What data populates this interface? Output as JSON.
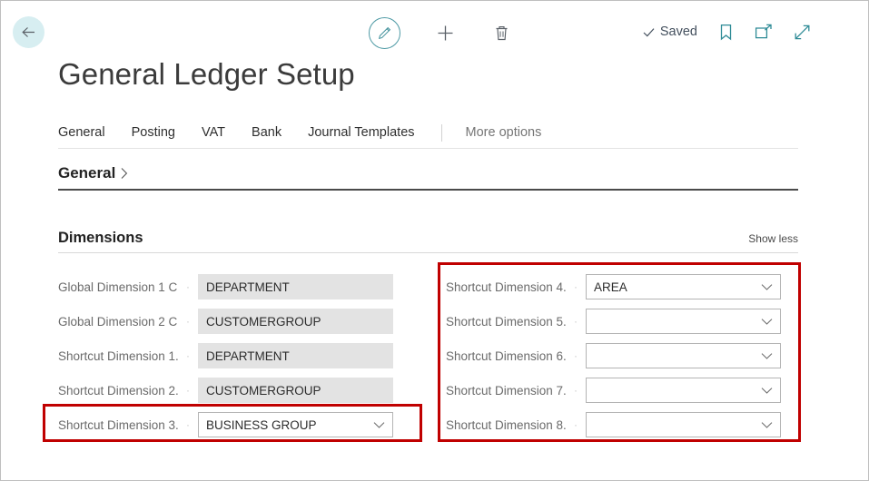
{
  "window": {
    "title": "General Ledger Setup"
  },
  "command_bar": {
    "back_label": "Back",
    "edit_label": "Edit",
    "new_label": "New",
    "delete_label": "Delete",
    "saved_status": "Saved",
    "bookmark_label": "Bookmark",
    "open_new_window_label": "Open in new window",
    "expand_label": "Expand"
  },
  "tabs": {
    "items": [
      {
        "label": "General"
      },
      {
        "label": "Posting"
      },
      {
        "label": "VAT"
      },
      {
        "label": "Bank"
      },
      {
        "label": "Journal Templates"
      }
    ],
    "more_options": "More options"
  },
  "general_section": {
    "title": "General"
  },
  "dimensions_section": {
    "title": "Dimensions",
    "show_less": "Show less",
    "left_fields": [
      {
        "label": "Global Dimension 1 C...",
        "value": "DEPARTMENT",
        "editable": false
      },
      {
        "label": "Global Dimension 2 C...",
        "value": "CUSTOMERGROUP",
        "editable": false
      },
      {
        "label": "Shortcut Dimension 1...",
        "value": "DEPARTMENT",
        "editable": false
      },
      {
        "label": "Shortcut Dimension 2...",
        "value": "CUSTOMERGROUP",
        "editable": false
      },
      {
        "label": "Shortcut Dimension 3...",
        "value": "BUSINESS GROUP",
        "editable": true
      }
    ],
    "right_fields": [
      {
        "label": "Shortcut Dimension 4...",
        "value": "AREA",
        "editable": true
      },
      {
        "label": "Shortcut Dimension 5...",
        "value": "",
        "editable": true
      },
      {
        "label": "Shortcut Dimension 6...",
        "value": "",
        "editable": true
      },
      {
        "label": "Shortcut Dimension 7...",
        "value": "",
        "editable": true
      },
      {
        "label": "Shortcut Dimension 8...",
        "value": "",
        "editable": true
      }
    ]
  },
  "colors": {
    "highlight": "#c00000",
    "teal": "#2e8b96",
    "back_circle": "#d7eef1",
    "readonly_field": "#e3e3e3"
  }
}
